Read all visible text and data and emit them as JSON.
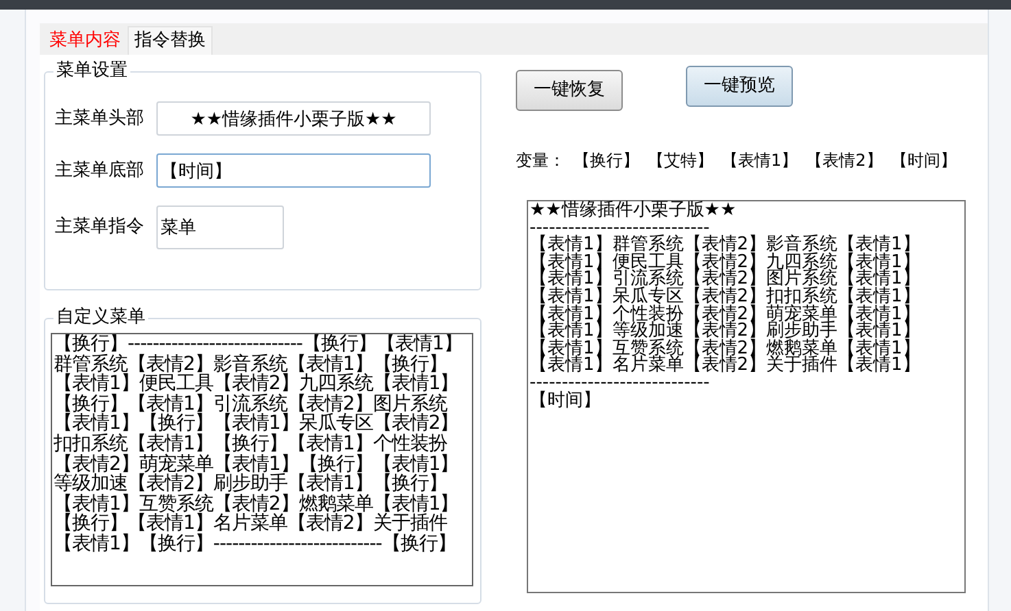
{
  "tabs": [
    {
      "label": "菜单内容",
      "selected": true
    },
    {
      "label": "指令替换",
      "selected": false
    }
  ],
  "menu_settings": {
    "title": "菜单设置",
    "fields": [
      {
        "label": "主菜单头部",
        "value": "★★惜缘插件小栗子版★★",
        "kind": "wide-centered",
        "focused": false
      },
      {
        "label": "主菜单底部",
        "value": "【时间】",
        "kind": "wide",
        "focused": true
      },
      {
        "label": "主菜单指令",
        "value": "菜单",
        "kind": "short",
        "focused": false
      }
    ]
  },
  "custom_menu": {
    "title": "自定义菜单",
    "value": "【换行】----------------------------【换行】【表情1】群管系统【表情2】影音系统【表情1】【换行】【表情1】便民工具【表情2】九四系统【表情1】【换行】【表情1】引流系统【表情2】图片系统【表情1】【换行】【表情1】呆瓜专区【表情2】扣扣系统【表情1】【换行】【表情1】个性装扮【表情2】萌宠菜单【表情1】【换行】【表情1】等级加速【表情2】刷步助手【表情1】【换行】【表情1】互赞系统【表情2】燃鹅菜单【表情1】【换行】【表情1】名片菜单【表情2】关于插件【表情1】【换行】---------------------------【换行】"
  },
  "buttons": [
    {
      "label": "一键恢复",
      "highlighted": false
    },
    {
      "label": "一键预览",
      "highlighted": true
    }
  ],
  "variables": {
    "label": "变量：",
    "items": [
      "【换行】",
      "【艾特】",
      "【表情1】",
      "【表情2】",
      "【时间】"
    ]
  },
  "preview": {
    "lines": [
      "★★惜缘插件小栗子版★★",
      "----------------------------",
      "【表情1】群管系统【表情2】影音系统【表情1】",
      "【表情1】便民工具【表情2】九四系统【表情1】",
      "【表情1】引流系统【表情2】图片系统【表情1】",
      "【表情1】呆瓜专区【表情2】扣扣系统【表情1】",
      "【表情1】个性装扮【表情2】萌宠菜单【表情1】",
      "【表情1】等级加速【表情2】刷步助手【表情1】",
      "【表情1】互赞系统【表情2】燃鹅菜单【表情1】",
      "【表情1】名片菜单【表情2】关于插件【表情1】",
      "----------------------------",
      "【时间】"
    ]
  }
}
